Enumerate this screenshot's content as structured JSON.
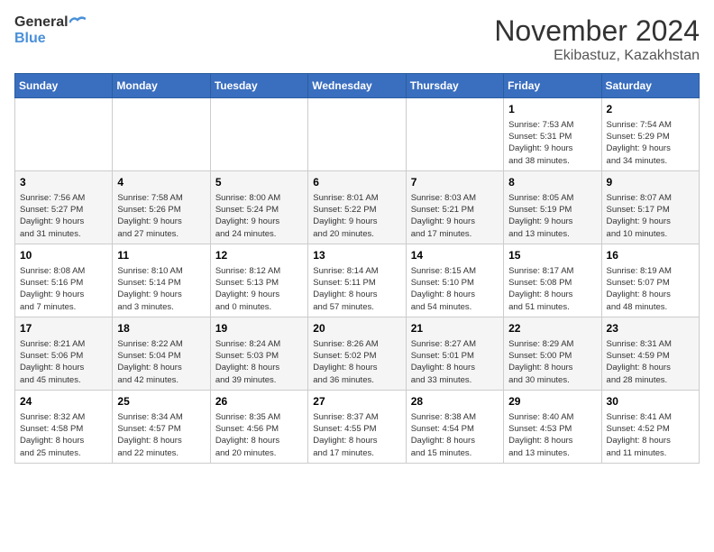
{
  "header": {
    "logo_line1": "General",
    "logo_line2": "Blue",
    "month": "November 2024",
    "location": "Ekibastuz, Kazakhstan"
  },
  "weekdays": [
    "Sunday",
    "Monday",
    "Tuesday",
    "Wednesday",
    "Thursday",
    "Friday",
    "Saturday"
  ],
  "weeks": [
    [
      {
        "day": "",
        "info": ""
      },
      {
        "day": "",
        "info": ""
      },
      {
        "day": "",
        "info": ""
      },
      {
        "day": "",
        "info": ""
      },
      {
        "day": "",
        "info": ""
      },
      {
        "day": "1",
        "info": "Sunrise: 7:53 AM\nSunset: 5:31 PM\nDaylight: 9 hours\nand 38 minutes."
      },
      {
        "day": "2",
        "info": "Sunrise: 7:54 AM\nSunset: 5:29 PM\nDaylight: 9 hours\nand 34 minutes."
      }
    ],
    [
      {
        "day": "3",
        "info": "Sunrise: 7:56 AM\nSunset: 5:27 PM\nDaylight: 9 hours\nand 31 minutes."
      },
      {
        "day": "4",
        "info": "Sunrise: 7:58 AM\nSunset: 5:26 PM\nDaylight: 9 hours\nand 27 minutes."
      },
      {
        "day": "5",
        "info": "Sunrise: 8:00 AM\nSunset: 5:24 PM\nDaylight: 9 hours\nand 24 minutes."
      },
      {
        "day": "6",
        "info": "Sunrise: 8:01 AM\nSunset: 5:22 PM\nDaylight: 9 hours\nand 20 minutes."
      },
      {
        "day": "7",
        "info": "Sunrise: 8:03 AM\nSunset: 5:21 PM\nDaylight: 9 hours\nand 17 minutes."
      },
      {
        "day": "8",
        "info": "Sunrise: 8:05 AM\nSunset: 5:19 PM\nDaylight: 9 hours\nand 13 minutes."
      },
      {
        "day": "9",
        "info": "Sunrise: 8:07 AM\nSunset: 5:17 PM\nDaylight: 9 hours\nand 10 minutes."
      }
    ],
    [
      {
        "day": "10",
        "info": "Sunrise: 8:08 AM\nSunset: 5:16 PM\nDaylight: 9 hours\nand 7 minutes."
      },
      {
        "day": "11",
        "info": "Sunrise: 8:10 AM\nSunset: 5:14 PM\nDaylight: 9 hours\nand 3 minutes."
      },
      {
        "day": "12",
        "info": "Sunrise: 8:12 AM\nSunset: 5:13 PM\nDaylight: 9 hours\nand 0 minutes."
      },
      {
        "day": "13",
        "info": "Sunrise: 8:14 AM\nSunset: 5:11 PM\nDaylight: 8 hours\nand 57 minutes."
      },
      {
        "day": "14",
        "info": "Sunrise: 8:15 AM\nSunset: 5:10 PM\nDaylight: 8 hours\nand 54 minutes."
      },
      {
        "day": "15",
        "info": "Sunrise: 8:17 AM\nSunset: 5:08 PM\nDaylight: 8 hours\nand 51 minutes."
      },
      {
        "day": "16",
        "info": "Sunrise: 8:19 AM\nSunset: 5:07 PM\nDaylight: 8 hours\nand 48 minutes."
      }
    ],
    [
      {
        "day": "17",
        "info": "Sunrise: 8:21 AM\nSunset: 5:06 PM\nDaylight: 8 hours\nand 45 minutes."
      },
      {
        "day": "18",
        "info": "Sunrise: 8:22 AM\nSunset: 5:04 PM\nDaylight: 8 hours\nand 42 minutes."
      },
      {
        "day": "19",
        "info": "Sunrise: 8:24 AM\nSunset: 5:03 PM\nDaylight: 8 hours\nand 39 minutes."
      },
      {
        "day": "20",
        "info": "Sunrise: 8:26 AM\nSunset: 5:02 PM\nDaylight: 8 hours\nand 36 minutes."
      },
      {
        "day": "21",
        "info": "Sunrise: 8:27 AM\nSunset: 5:01 PM\nDaylight: 8 hours\nand 33 minutes."
      },
      {
        "day": "22",
        "info": "Sunrise: 8:29 AM\nSunset: 5:00 PM\nDaylight: 8 hours\nand 30 minutes."
      },
      {
        "day": "23",
        "info": "Sunrise: 8:31 AM\nSunset: 4:59 PM\nDaylight: 8 hours\nand 28 minutes."
      }
    ],
    [
      {
        "day": "24",
        "info": "Sunrise: 8:32 AM\nSunset: 4:58 PM\nDaylight: 8 hours\nand 25 minutes."
      },
      {
        "day": "25",
        "info": "Sunrise: 8:34 AM\nSunset: 4:57 PM\nDaylight: 8 hours\nand 22 minutes."
      },
      {
        "day": "26",
        "info": "Sunrise: 8:35 AM\nSunset: 4:56 PM\nDaylight: 8 hours\nand 20 minutes."
      },
      {
        "day": "27",
        "info": "Sunrise: 8:37 AM\nSunset: 4:55 PM\nDaylight: 8 hours\nand 17 minutes."
      },
      {
        "day": "28",
        "info": "Sunrise: 8:38 AM\nSunset: 4:54 PM\nDaylight: 8 hours\nand 15 minutes."
      },
      {
        "day": "29",
        "info": "Sunrise: 8:40 AM\nSunset: 4:53 PM\nDaylight: 8 hours\nand 13 minutes."
      },
      {
        "day": "30",
        "info": "Sunrise: 8:41 AM\nSunset: 4:52 PM\nDaylight: 8 hours\nand 11 minutes."
      }
    ]
  ]
}
